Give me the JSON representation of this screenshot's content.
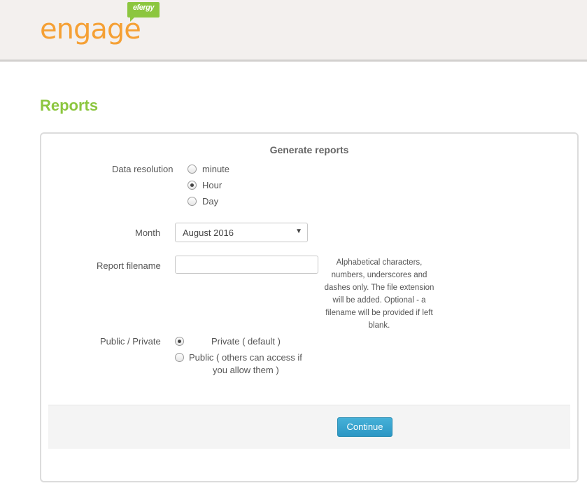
{
  "brand": {
    "logo_word": "engage",
    "logo_bubble": "efergy",
    "accent_orange": "#f5a034",
    "accent_green": "#8cc63f"
  },
  "page": {
    "title": "Reports"
  },
  "form": {
    "heading": "Generate reports",
    "resolution": {
      "label": "Data resolution",
      "options": [
        {
          "label": "minute",
          "checked": false
        },
        {
          "label": "Hour",
          "checked": true
        },
        {
          "label": "Day",
          "checked": false
        }
      ]
    },
    "month": {
      "label": "Month",
      "value": "August 2016"
    },
    "filename": {
      "label": "Report filename",
      "value": "",
      "help": "Alphabetical characters, numbers, underscores and dashes only. The file extension will be added. Optional - a filename will be provided if left blank."
    },
    "visibility": {
      "label": "Public / Private",
      "options": [
        {
          "label": "Private ( default )",
          "checked": true
        },
        {
          "label_line1": "Public ( others can access if",
          "label_line2": "you allow them )",
          "checked": false
        }
      ]
    },
    "continue_label": "Continue"
  }
}
